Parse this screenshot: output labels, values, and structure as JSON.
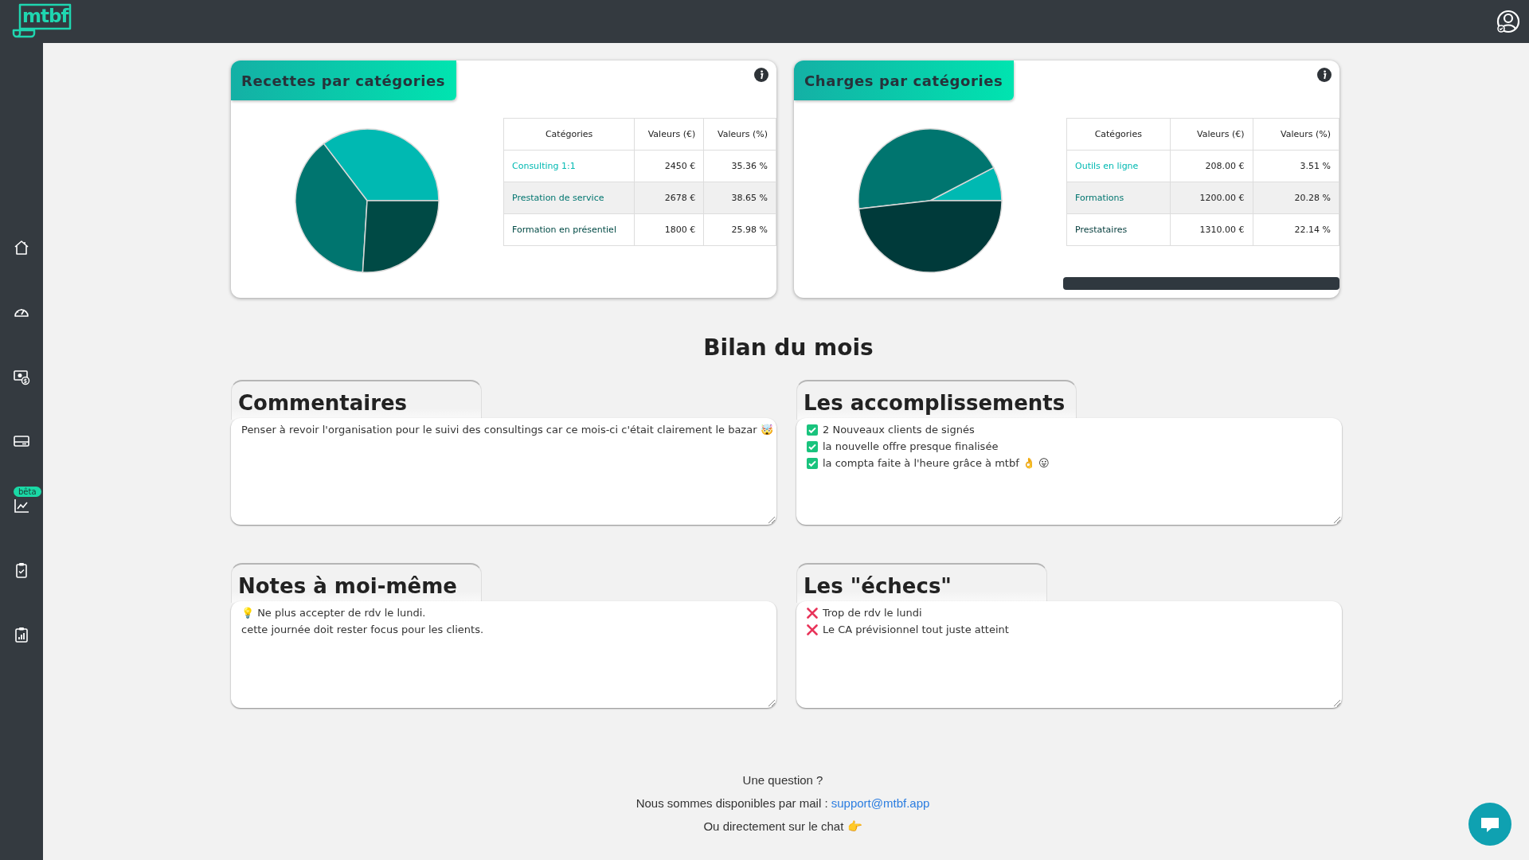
{
  "header": {
    "logo": "mtbf"
  },
  "sidebar": {
    "items": [
      {
        "kind": "home"
      },
      {
        "kind": "gauge"
      },
      {
        "kind": "money"
      },
      {
        "kind": "card"
      },
      {
        "kind": "chart",
        "badge": "bêta"
      },
      {
        "kind": "clipboard-check"
      },
      {
        "kind": "clipboard-chart"
      }
    ]
  },
  "cards": [
    {
      "title": "Recettes par catégories",
      "scrollbar": false,
      "table": {
        "category_header": "Catégories",
        "columns": [
          "Valeurs (€)",
          "Valeurs (%)"
        ],
        "rows": [
          {
            "cells": [
              "2450 €",
              "35.36 %"
            ],
            "color": "#00b9b2"
          },
          {
            "cells": [
              "2678 €",
              "38.65 %"
            ],
            "color": "#00756f"
          },
          {
            "cells": [
              "1800 €",
              "25.98 %"
            ],
            "color": "#004a45"
          }
        ]
      },
      "chart_data": {
        "type": "pie",
        "categories": [
          "Consulting 1:1",
          "Prestation de service",
          "Formation en présentiel"
        ],
        "values": [
          35.36,
          38.65,
          25.98
        ]
      }
    },
    {
      "title": "Charges par catégories",
      "scrollbar": true,
      "table": {
        "category_header": "Catégories",
        "columns": [
          "Valeurs (€)",
          "Valeurs (%)"
        ],
        "rows": [
          {
            "cells": [
              "208.00 €",
              "3.51 %"
            ],
            "color": "#00b9b2"
          },
          {
            "cells": [
              "1200.00 €",
              "20.28 %"
            ],
            "color": "#00756f"
          },
          {
            "cells": [
              "1310.00 €",
              "22.14 %"
            ],
            "color": "#003a3a"
          }
        ]
      },
      "chart_data": {
        "type": "pie",
        "categories": [
          "Outils en ligne",
          "Formations",
          "Prestataires"
        ],
        "values": [
          7.65,
          44.15,
          48.2
        ]
      }
    }
  ],
  "summary": {
    "title": "Bilan du mois",
    "panels": [
      {
        "title": "Commentaires",
        "lines": [
          {
            "kind": "text",
            "text": "Penser à revoir l'organisation pour le suivi des consultings car ce mois-ci c'était clairement le bazar 🤯"
          }
        ]
      },
      {
        "title": "Les accomplissements",
        "lines": [
          {
            "kind": "check",
            "text": "2 Nouveaux clients de signés"
          },
          {
            "kind": "check",
            "text": "la nouvelle offre presque finalisée"
          },
          {
            "kind": "check",
            "text": "la compta faite à l'heure grâce à mtbf 👌 😛"
          }
        ]
      },
      {
        "title": "Notes à moi-même",
        "lines": [
          {
            "kind": "text",
            "text": "💡  Ne plus accepter de rdv le lundi."
          },
          {
            "kind": "text",
            "text": "cette journée doit rester focus pour les clients."
          }
        ]
      },
      {
        "title": "Les \"échecs\"",
        "lines": [
          {
            "kind": "cross",
            "text": "Trop de rdv le lundi"
          },
          {
            "kind": "cross",
            "text": "Le CA prévisionnel tout juste atteint"
          }
        ]
      }
    ]
  },
  "footer": {
    "question": "Une question ?",
    "mail_text": "Nous sommes disponibles par mail :",
    "mail_link": "support@mtbf.app",
    "chat_text": "Ou directement sur le chat 👉"
  }
}
